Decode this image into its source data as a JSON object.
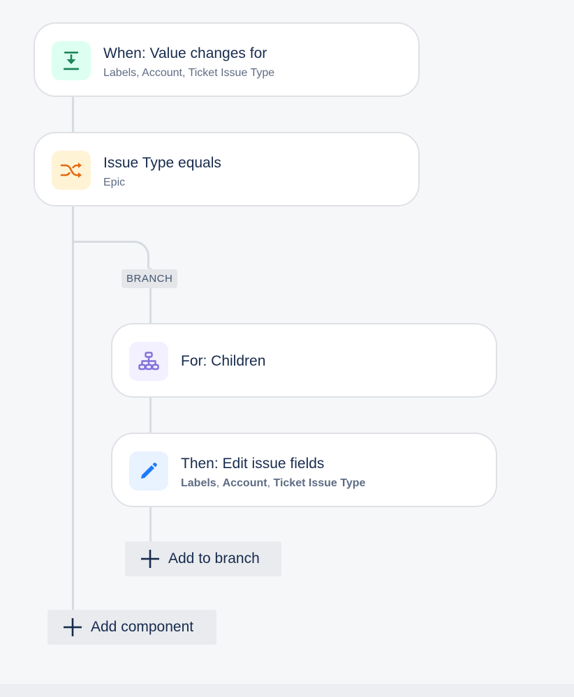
{
  "trigger": {
    "title": "When: Value changes for",
    "subtitle": "Labels, Account, Ticket Issue Type",
    "icon": "download-arrow-icon",
    "icon_color": "#1f845a",
    "icon_bg": "#dcfff1"
  },
  "condition": {
    "title": "Issue Type equals",
    "subtitle": "Epic",
    "icon": "shuffle-icon",
    "icon_color": "#e56910",
    "icon_bg": "#fff3d6"
  },
  "branch": {
    "tag": "BRANCH",
    "for_card": {
      "title": "For: Children",
      "icon": "hierarchy-icon",
      "icon_color": "#8270db",
      "icon_bg": "#f3f0ff"
    },
    "action_card": {
      "title": "Then: Edit issue fields",
      "fields": [
        "Labels",
        "Account",
        "Ticket Issue Type"
      ],
      "separator": ", ",
      "icon": "pencil-icon",
      "icon_color": "#1d7afc",
      "icon_bg": "#e9f2ff"
    },
    "add_label": "Add to branch"
  },
  "add_component_label": "Add component"
}
